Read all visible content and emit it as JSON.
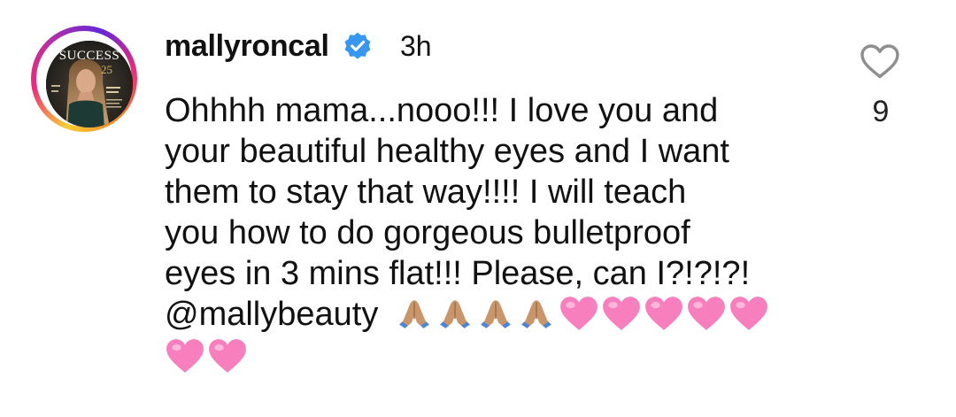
{
  "comment": {
    "username": "mallyroncal",
    "verified": true,
    "timestamp": "3h",
    "avatar": {
      "magazine_title": "SUCCESS",
      "magazine_issue": "25"
    },
    "lines": [
      "Ohhhh mama...nooo!!! I love you and",
      "your beautiful healthy eyes and I want",
      "them to stay that way!!!! I will teach",
      "you how to do gorgeous bulletproof",
      "eyes in 3 mins flat!!! Please, can I?!?!?!",
      "@mallybeauty"
    ],
    "emojis_line6": [
      "folded-hands",
      "folded-hands",
      "folded-hands",
      "folded-hands",
      "pink-heart",
      "pink-heart",
      "pink-heart",
      "pink-heart",
      "pink-heart"
    ],
    "emojis_line7": [
      "pink-heart",
      "pink-heart"
    ],
    "like_count": "9"
  },
  "colors": {
    "verified_blue": "#3897f0",
    "heart_pink": "#f77fbe",
    "hands_skin": "#c8966a",
    "hands_sleeve": "#4a86d6",
    "text": "#111111"
  },
  "icons": {
    "verified": "verified-badge-icon",
    "like": "heart-outline-icon"
  }
}
